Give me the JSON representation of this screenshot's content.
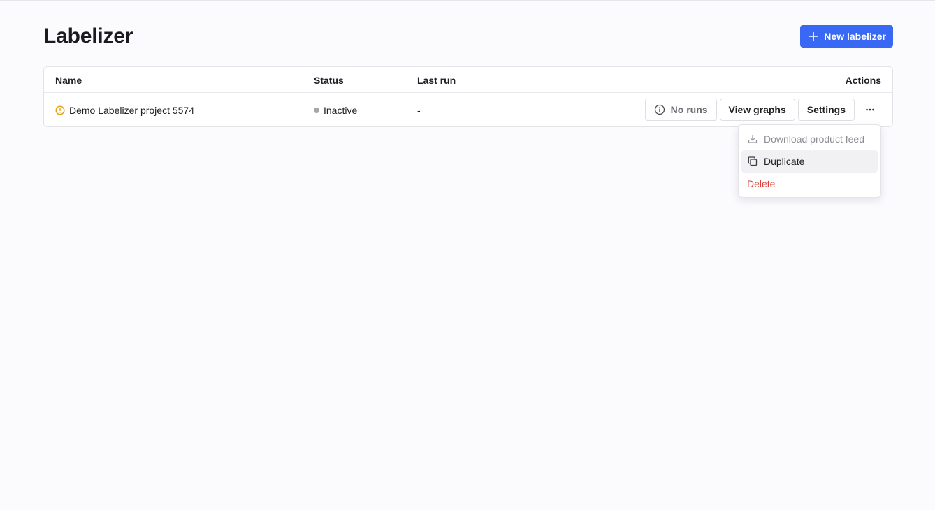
{
  "page": {
    "title": "Labelizer",
    "new_button_label": "New labelizer"
  },
  "table": {
    "columns": {
      "name": "Name",
      "status": "Status",
      "last_run": "Last run",
      "actions": "Actions"
    },
    "rows": [
      {
        "name": "Demo Labelizer project 5574",
        "status": "Inactive",
        "last_run": "-",
        "actions": {
          "no_runs": "No runs",
          "view_graphs": "View graphs",
          "settings": "Settings"
        }
      }
    ]
  },
  "menu": {
    "items": [
      {
        "label": "Download product feed",
        "icon": "download-icon",
        "state": "disabled"
      },
      {
        "label": "Duplicate",
        "icon": "duplicate-icon",
        "state": "hover"
      },
      {
        "label": "Delete",
        "icon": "",
        "state": "danger"
      }
    ]
  },
  "colors": {
    "primary": "#3868f4",
    "warning": "#e3a008",
    "danger": "#d9413a",
    "inactive_dot": "#a6a6ad"
  }
}
